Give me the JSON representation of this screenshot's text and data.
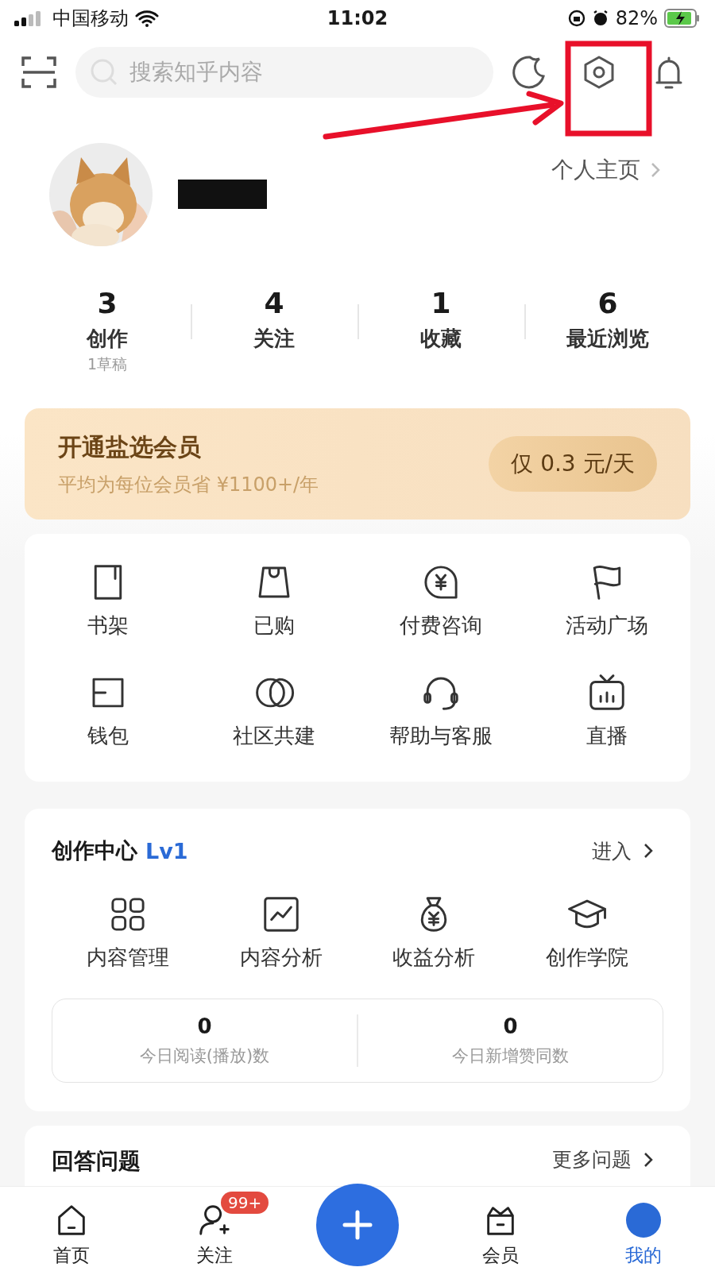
{
  "status_bar": {
    "carrier": "中国移动",
    "time": "11:02",
    "battery": "82%"
  },
  "top_bar": {
    "search_placeholder": "搜索知乎内容"
  },
  "profile": {
    "link": "个人主页"
  },
  "stats": [
    {
      "value": "3",
      "label": "创作",
      "note": "1草稿"
    },
    {
      "value": "4",
      "label": "关注"
    },
    {
      "value": "1",
      "label": "收藏"
    },
    {
      "value": "6",
      "label": "最近浏览"
    }
  ],
  "vip": {
    "title": "开通盐选会员",
    "subtitle": "平均为每位会员省 ¥1100+/年",
    "button": "仅 0.3 元/天"
  },
  "tools": [
    "书架",
    "已购",
    "付费咨询",
    "活动广场",
    "钱包",
    "社区共建",
    "帮助与客服",
    "直播"
  ],
  "creator": {
    "title": "创作中心",
    "level": "Lv1",
    "enter": "进入",
    "tools": [
      "内容管理",
      "内容分析",
      "收益分析",
      "创作学院"
    ],
    "metrics": [
      {
        "value": "0",
        "label": "今日阅读(播放)数"
      },
      {
        "value": "0",
        "label": "今日新增赞同数"
      }
    ]
  },
  "answers": {
    "title": "回答问题",
    "more": "更多问题"
  },
  "tab_bar": [
    {
      "label": "首页",
      "selected": false
    },
    {
      "label": "关注",
      "selected": false,
      "badge": "99+"
    },
    {
      "kind": "add"
    },
    {
      "label": "会员",
      "selected": false
    },
    {
      "label": "我的",
      "selected": true
    }
  ]
}
